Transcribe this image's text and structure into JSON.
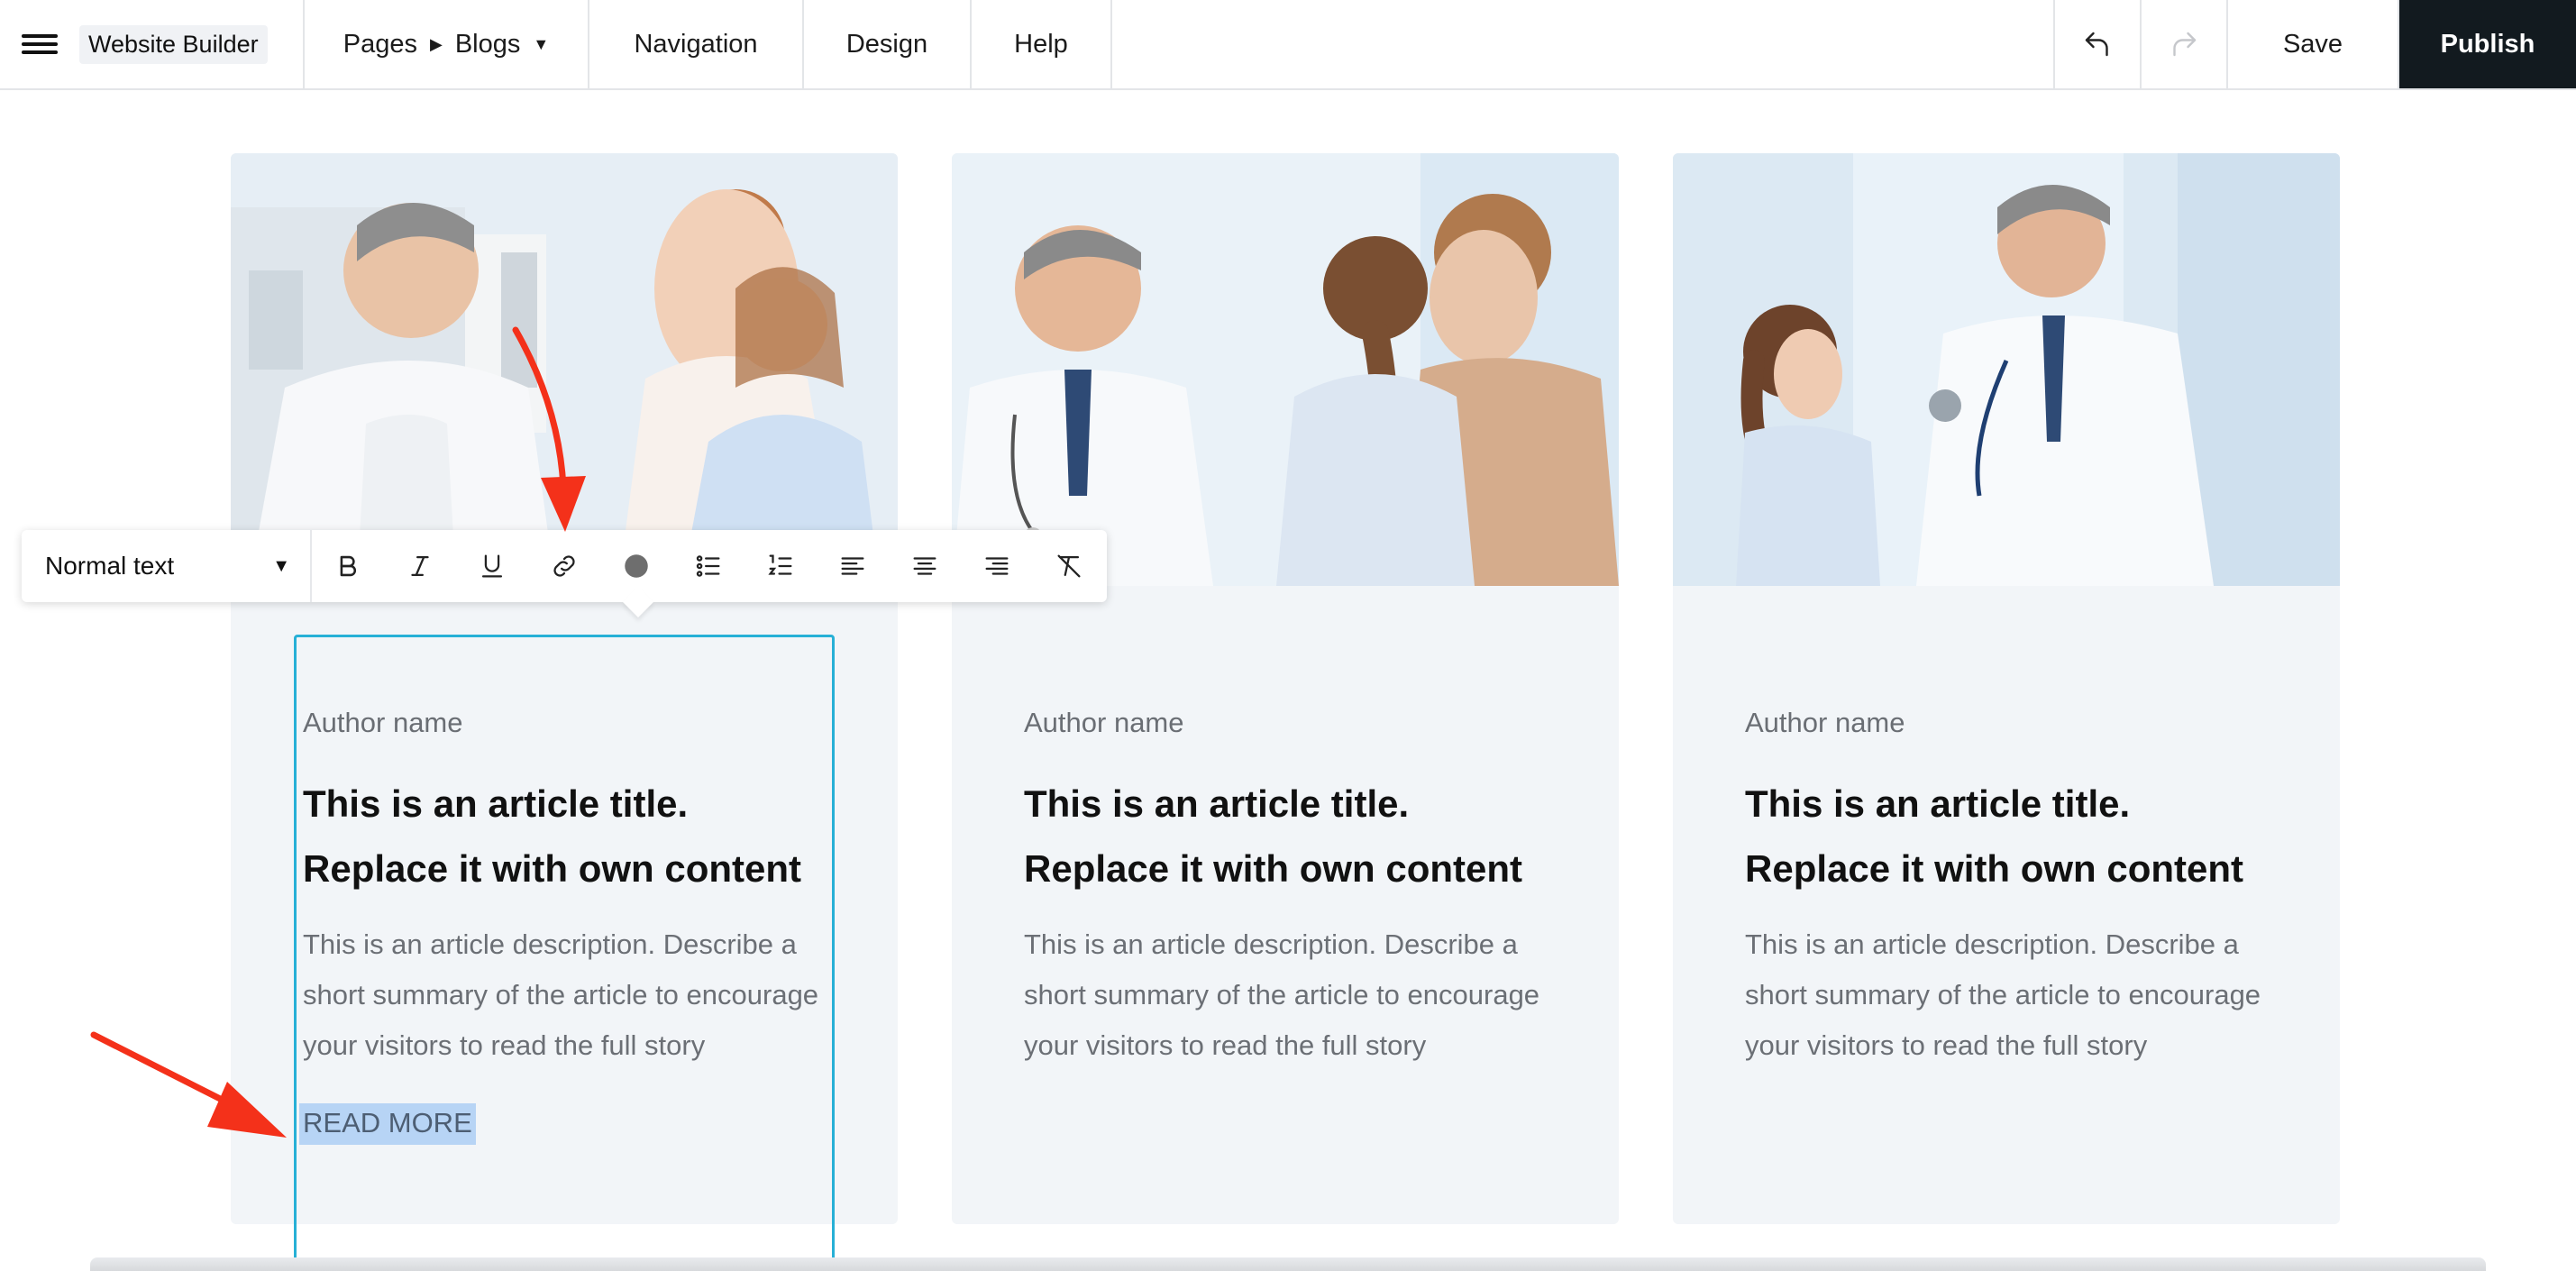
{
  "topbar": {
    "brand": "Website Builder",
    "pages_label": "Pages",
    "current_page": "Blogs",
    "nav_label": "Navigation",
    "design_label": "Design",
    "help_label": "Help",
    "save_label": "Save",
    "publish_label": "Publish"
  },
  "toolbar": {
    "text_style": "Normal text",
    "tools": [
      "bold-icon",
      "italic-icon",
      "underline-icon",
      "link-icon",
      "text-color-icon",
      "bullet-list-icon",
      "numbered-list-icon",
      "align-left-icon",
      "align-center-icon",
      "align-right-icon",
      "clear-format-icon"
    ],
    "text_color": "#6e6e6e"
  },
  "cards": [
    {
      "author": "Author name",
      "title_line1": "This is an article title.",
      "title_line2": "Replace it with own content",
      "description": "This is an article description. Describe a short summary of the article to encourage your visitors to read the full story",
      "read_more": "READ MORE"
    },
    {
      "author": "Author name",
      "title_line1": "This is an article title.",
      "title_line2": "Replace it with own content",
      "description": "This is an article description. Describe a short summary of the article to encourage your visitors to read the full story",
      "read_more": ""
    },
    {
      "author": "Author name",
      "title_line1": "This is an article title.",
      "title_line2": "Replace it with own content",
      "description": "This is an article description. Describe a short summary of the article to encourage your visitors to read the full story",
      "read_more": ""
    }
  ],
  "colors": {
    "selection_border": "#27b0d6",
    "selection_highlight": "#b7d4f5",
    "annotation_arrow": "#f4311a",
    "publish_bg": "#121a1f"
  }
}
